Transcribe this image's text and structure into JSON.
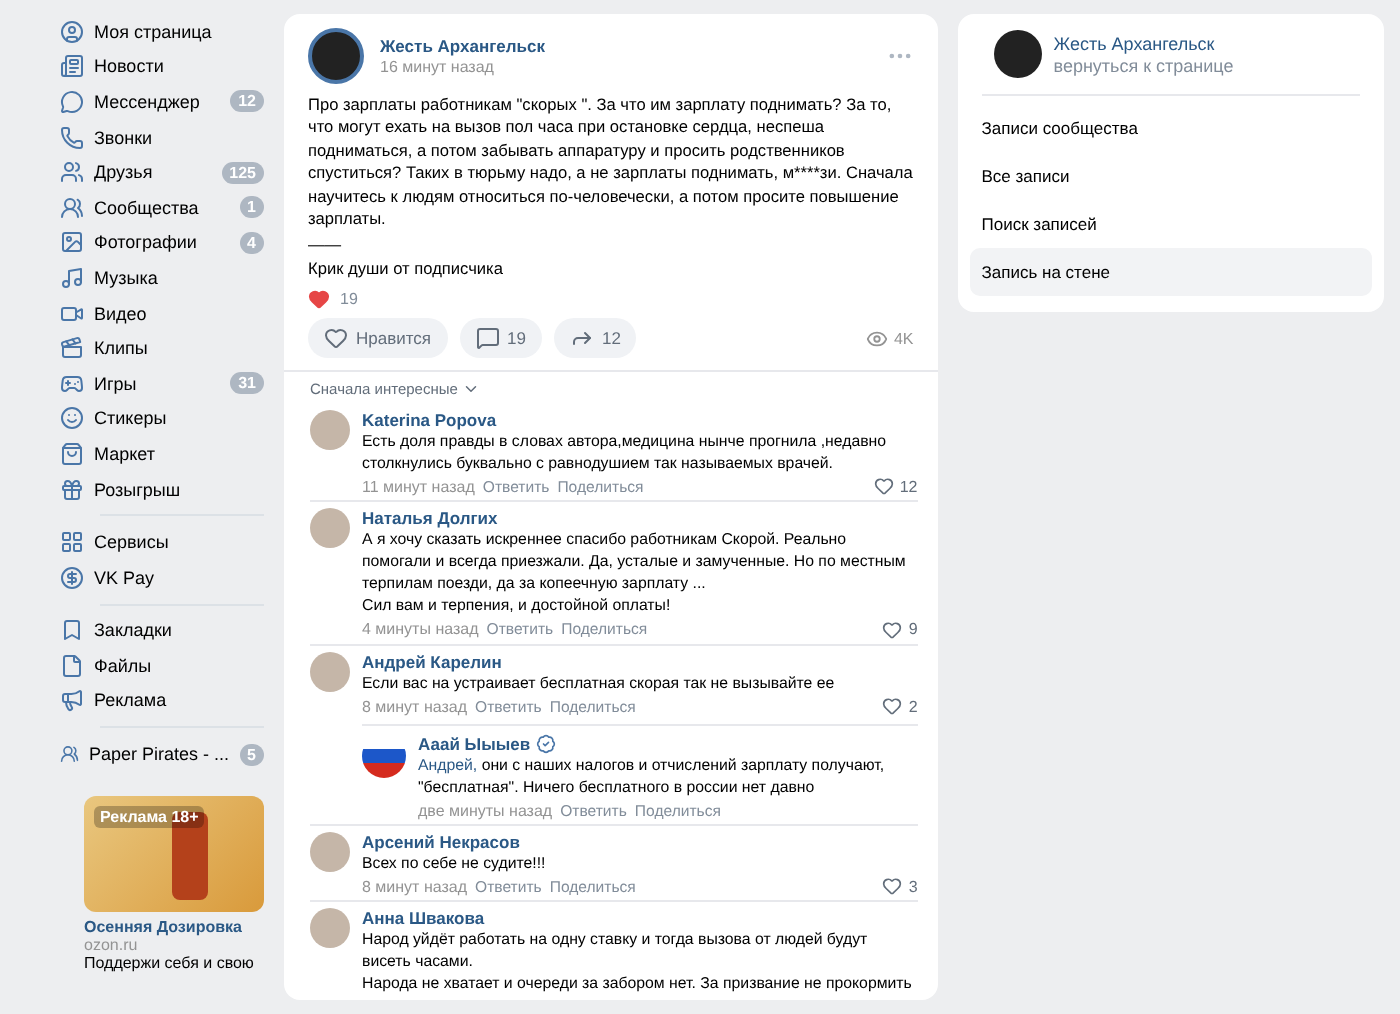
{
  "sidebar": {
    "groups": [
      [
        {
          "label": "Моя страница"
        },
        {
          "label": "Новости"
        },
        {
          "label": "Мессенджер",
          "badge": "12"
        },
        {
          "label": "Звонки"
        },
        {
          "label": "Друзья",
          "badge": "125"
        },
        {
          "label": "Сообщества",
          "badge": "1"
        },
        {
          "label": "Фотографии",
          "badge": "4"
        },
        {
          "label": "Музыка"
        },
        {
          "label": "Видео"
        },
        {
          "label": "Клипы"
        },
        {
          "label": "Игры",
          "badge": "31"
        },
        {
          "label": "Стикеры"
        },
        {
          "label": "Маркет"
        },
        {
          "label": "Розыгрыш"
        }
      ],
      [
        {
          "label": "Сервисы"
        },
        {
          "label": "VK Pay"
        }
      ],
      [
        {
          "label": "Закладки"
        },
        {
          "label": "Файлы"
        },
        {
          "label": "Реклама"
        }
      ],
      [
        {
          "label": "Paper Pirates - ...",
          "badge": "5"
        }
      ]
    ],
    "ad": {
      "label": "Реклама 18+",
      "title": "Осенняя Дозировка",
      "domain": "ozon.ru",
      "text": "Поддержи себя и свою"
    }
  },
  "post": {
    "author": "Жесть Архангельск",
    "time": "16 минут назад",
    "text": "Про зарплаты работникам \"скорых \". За что им зарплату поднимать? За то, что могут ехать на вызов пол часа при остановке сердца, неспеша подниматься, а потом забывать аппаратуру и просить родственников спуститься? Таких в тюрьму надо, а не зарплаты поднимать, м****зи. Сначала научитесь к людям относиться по-человечески, а потом просите повышение зарплаты.",
    "separator": "——",
    "signature": "Крик души от подписчика",
    "reactions": "19",
    "like_label": "Нравится",
    "comments": "19",
    "shares": "12",
    "views": "4K"
  },
  "comments": {
    "sort": "Сначала интересные",
    "items": [
      {
        "author": "Katerina Popova",
        "paragraphs": [
          "Есть доля правды в словах автора,медицина нынче прогнила ,недавно столкнулись буквально с равнодушием так называемых врачей."
        ],
        "time": "11 минут назад",
        "reply": "Ответить",
        "share": "Поделиться",
        "likes": "12"
      },
      {
        "author": "Наталья Долгих",
        "paragraphs": [
          "А я хочу сказать искреннее спасибо работникам Скорой. Реально помогали и всегда приезжали. Да, усталые и замученные. Но по местным терпилам поезди, да за копеечную зарплату ...",
          "Сил вам и терпения, и достойной оплаты!"
        ],
        "time": "4 минуты назад",
        "reply": "Ответить",
        "share": "Поделиться",
        "likes": "9"
      },
      {
        "author": "Андрей Карелин",
        "paragraphs": [
          "Если вас на устраивает бесплатная скорая так не вызывайте ее"
        ],
        "time": "8 минут назад",
        "reply": "Ответить",
        "share": "Поделиться",
        "likes": "2",
        "children": [
          {
            "author": "Ааай Ыыыев",
            "addressee": "Андрей,",
            "paragraphs": [
              "они с наших налогов и отчислений зарплату получают, \"бесплатная\". Ничего бесплатного в россии нет давно"
            ],
            "time": "две минуты назад",
            "reply": "Ответить",
            "share": "Поделиться"
          }
        ]
      },
      {
        "author": "Арсений Некрасов",
        "paragraphs": [
          "Всех по себе не судите!!!"
        ],
        "time": "8 минут назад",
        "reply": "Ответить",
        "share": "Поделиться",
        "likes": "3"
      },
      {
        "author": "Анна Швакова",
        "paragraphs": [
          "Народ уйдёт работать на одну ставку и тогда вызова от людей будут висеть часами.",
          "Народа не хватает и очереди за забором нет. За призвание не прокормить"
        ]
      }
    ]
  },
  "community": {
    "name": "Жесть Архангельск",
    "back": "вернуться к странице",
    "menu": [
      {
        "label": "Записи сообщества",
        "selected": false
      },
      {
        "label": "Все записи",
        "selected": false
      },
      {
        "label": "Поиск записей",
        "selected": false
      },
      {
        "label": "Запись на стене",
        "selected": true
      }
    ]
  }
}
